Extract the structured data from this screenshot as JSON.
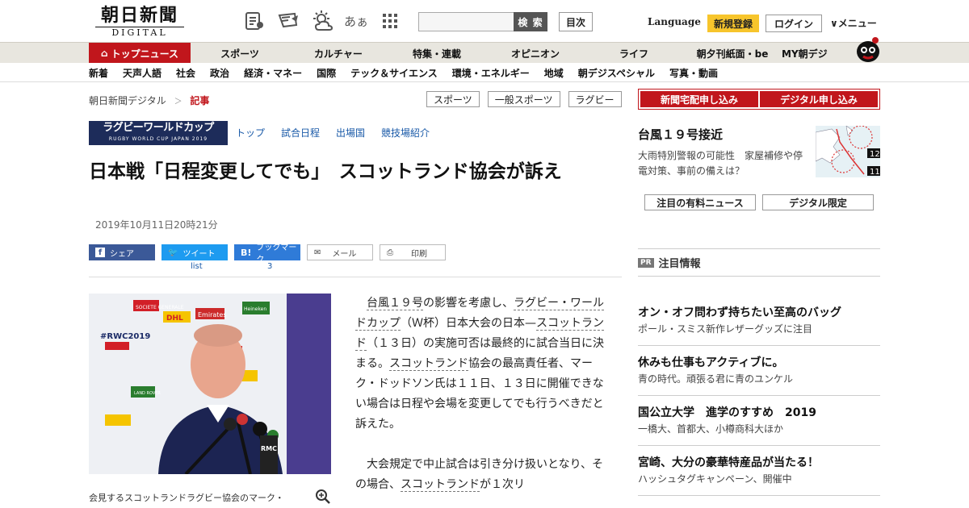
{
  "header": {
    "logo_jp": "朝日新聞",
    "logo_en": "DIGITAL",
    "icons": [
      "newspaper-icon",
      "message-icon",
      "weather-icon",
      "font-size-icon",
      "grid-icon"
    ],
    "font_size_label": "あぁ",
    "search_button": "検 索",
    "mokuji": "目次",
    "language": "Language",
    "register": "新規登録",
    "login": "ログイン",
    "menu": "メニュー"
  },
  "nav_primary": [
    "トップニュース",
    "スポーツ",
    "カルチャー",
    "特集・連載",
    "オピニオン",
    "ライフ",
    "朝夕刊紙面・be",
    "MY朝デジ"
  ],
  "nav_secondary": [
    "新着",
    "天声人語",
    "社会",
    "政治",
    "経済・マネー",
    "国際",
    "テック＆サイエンス",
    "環境・エネルギー",
    "地域",
    "朝デジスペシャル",
    "写真・動画"
  ],
  "breadcrumb": {
    "home": "朝日新聞デジタル",
    "sep": "＞",
    "current": "記事"
  },
  "tags": [
    "スポーツ",
    "一般スポーツ",
    "ラグビー"
  ],
  "rwc": {
    "logo_jp": "ラグビーワールドカップ",
    "logo_en": "RUGBY WORLD CUP JAPAN 2019",
    "links": [
      "トップ",
      "試合日程",
      "出場国",
      "競技場紹介"
    ]
  },
  "article": {
    "title": "日本戦「日程変更してでも」　スコットランド協会が訴え",
    "date": "2019年10月11日20時21分",
    "share": {
      "facebook": "シェア",
      "twitter": "ツイート",
      "hatena": "ブックマーク",
      "mail": "メール",
      "print": "印刷",
      "tweet_count": "list",
      "hatena_count": "3"
    },
    "caption": "会見するスコットランドラグビー協会のマーク・",
    "p1": [
      "台風１９号",
      "の影響を考慮し、",
      "ラグビー・ワールドカップ",
      "（Ｗ杯）日本大会の日本—",
      "スコットランド",
      "（１３日）の実施可否は最終的に試合当日に決まる。",
      "スコットランド",
      "協会の最高責任者、マーク・ドッドソン氏は１１日、１３日に開催できない場合は日程や会場を変更してでも行うべきだと訴えた。"
    ],
    "p2": [
      "大会規定で中止試合は引き分け扱いとなり、その場合、",
      "スコットランド",
      "が１次リ"
    ]
  },
  "right": {
    "subscribe": [
      "新聞宅配申し込み",
      "デジタル申し込み"
    ],
    "typhoon": {
      "title": "台風１９号接近",
      "sub": "大雨特別警報の可能性　家屋補修や停電対策、事前の備えは？",
      "map_labels": [
        "12",
        "11"
      ]
    },
    "buttons": [
      "注目の有料ニュース",
      "デジタル限定"
    ],
    "pr_badge": "PR",
    "pr_title": "注目情報",
    "ads": [
      {
        "h": "オン・オフ問わず持ちたい至高のバッグ",
        "s": "ポール・スミス新作レザーグッズに注目"
      },
      {
        "h": "休みも仕事もアクティブに。",
        "s": "青の時代。頑張る君に青のユンケル"
      },
      {
        "h": "国公立大学　進学のすすめ　2019",
        "s": "一橋大、首都大、小樽商科大ほか"
      },
      {
        "h": "宮崎、大分の豪華特産品が当たる！",
        "s": "ハッシュタグキャンペーン、開催中"
      }
    ]
  },
  "photo_texts": [
    "SOCIETE GENERALE",
    "DHL",
    "Emirates",
    "Heineken",
    "LAND ROVER",
    "#RWC2019",
    "RMC"
  ]
}
